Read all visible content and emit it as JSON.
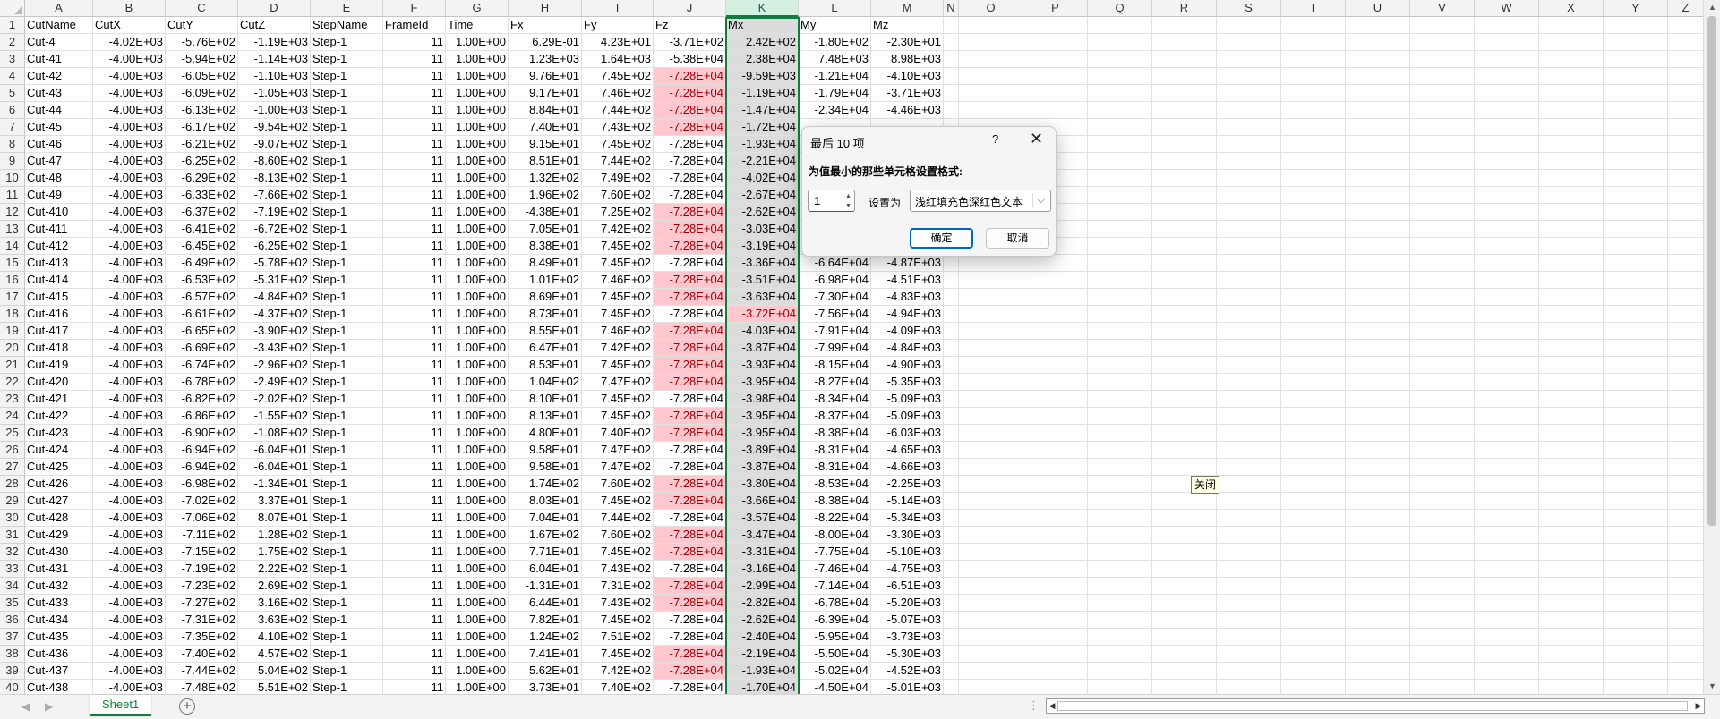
{
  "sheet": {
    "columns": [
      "A",
      "B",
      "C",
      "D",
      "E",
      "F",
      "G",
      "H",
      "I",
      "J",
      "K",
      "L",
      "M",
      "N",
      "O",
      "P",
      "Q",
      "R",
      "S",
      "T",
      "U",
      "V",
      "W",
      "X",
      "Y",
      "Z"
    ],
    "selected_column": "K",
    "row_numbers": [
      "1",
      "2",
      "3",
      "4",
      "5",
      "6",
      "7",
      "8",
      "9",
      "10",
      "11",
      "12",
      "13",
      "14",
      "15",
      "16",
      "17",
      "18",
      "19",
      "20",
      "21",
      "22",
      "23",
      "24",
      "25",
      "26",
      "27",
      "28",
      "29",
      "30",
      "31",
      "32",
      "33",
      "34",
      "35",
      "36",
      "37",
      "38",
      "39",
      "40"
    ],
    "headers": [
      "CutName",
      "CutX",
      "CutY",
      "CutZ",
      "StepName",
      "FrameId",
      "Time",
      "Fx",
      "Fy",
      "Fz",
      "Mx",
      "My",
      "Mz"
    ],
    "rows": [
      [
        "Cut-4",
        "-4.02E+03",
        "-5.76E+02",
        "-1.19E+03",
        "Step-1",
        "11",
        "1.00E+00",
        "6.29E-01",
        "4.23E+01",
        "-3.71E+02",
        "2.42E+02",
        "-1.80E+02",
        "-2.30E+01"
      ],
      [
        "Cut-41",
        "-4.00E+03",
        "-5.94E+02",
        "-1.14E+03",
        "Step-1",
        "11",
        "1.00E+00",
        "1.23E+03",
        "1.64E+03",
        "-5.38E+04",
        "2.38E+04",
        "7.48E+03",
        "8.98E+03"
      ],
      [
        "Cut-42",
        "-4.00E+03",
        "-6.05E+02",
        "-1.10E+03",
        "Step-1",
        "11",
        "1.00E+00",
        "9.76E+01",
        "7.45E+02",
        "-7.28E+04",
        "-9.59E+03",
        "-1.21E+04",
        "-4.10E+03"
      ],
      [
        "Cut-43",
        "-4.00E+03",
        "-6.09E+02",
        "-1.05E+03",
        "Step-1",
        "11",
        "1.00E+00",
        "9.17E+01",
        "7.46E+02",
        "-7.28E+04",
        "-1.19E+04",
        "-1.79E+04",
        "-3.71E+03"
      ],
      [
        "Cut-44",
        "-4.00E+03",
        "-6.13E+02",
        "-1.00E+03",
        "Step-1",
        "11",
        "1.00E+00",
        "8.84E+01",
        "7.44E+02",
        "-7.28E+04",
        "-1.47E+04",
        "-2.34E+04",
        "-4.46E+03"
      ],
      [
        "Cut-45",
        "-4.00E+03",
        "-6.17E+02",
        "-9.54E+02",
        "Step-1",
        "11",
        "1.00E+00",
        "7.40E+01",
        "7.43E+02",
        "-7.28E+04",
        "-1.72E+04",
        "",
        ""
      ],
      [
        "Cut-46",
        "-4.00E+03",
        "-6.21E+02",
        "-9.07E+02",
        "Step-1",
        "11",
        "1.00E+00",
        "9.15E+01",
        "7.45E+02",
        "-7.28E+04",
        "-1.93E+04",
        "",
        ""
      ],
      [
        "Cut-47",
        "-4.00E+03",
        "-6.25E+02",
        "-8.60E+02",
        "Step-1",
        "11",
        "1.00E+00",
        "8.51E+01",
        "7.44E+02",
        "-7.28E+04",
        "-2.21E+04",
        "",
        ""
      ],
      [
        "Cut-48",
        "-4.00E+03",
        "-6.29E+02",
        "-8.13E+02",
        "Step-1",
        "11",
        "1.00E+00",
        "1.32E+02",
        "7.49E+02",
        "-7.28E+04",
        "-4.02E+04",
        "",
        ""
      ],
      [
        "Cut-49",
        "-4.00E+03",
        "-6.33E+02",
        "-7.66E+02",
        "Step-1",
        "11",
        "1.00E+00",
        "1.96E+02",
        "7.60E+02",
        "-7.28E+04",
        "-2.67E+04",
        "",
        ""
      ],
      [
        "Cut-410",
        "-4.00E+03",
        "-6.37E+02",
        "-7.19E+02",
        "Step-1",
        "11",
        "1.00E+00",
        "-4.38E+01",
        "7.25E+02",
        "-7.28E+04",
        "-2.62E+04",
        "",
        ""
      ],
      [
        "Cut-411",
        "-4.00E+03",
        "-6.41E+02",
        "-6.72E+02",
        "Step-1",
        "11",
        "1.00E+00",
        "7.05E+01",
        "7.42E+02",
        "-7.28E+04",
        "-3.03E+04",
        "",
        ""
      ],
      [
        "Cut-412",
        "-4.00E+03",
        "-6.45E+02",
        "-6.25E+02",
        "Step-1",
        "11",
        "1.00E+00",
        "8.38E+01",
        "7.45E+02",
        "-7.28E+04",
        "-3.19E+04",
        "",
        ""
      ],
      [
        "Cut-413",
        "-4.00E+03",
        "-6.49E+02",
        "-5.78E+02",
        "Step-1",
        "11",
        "1.00E+00",
        "8.49E+01",
        "7.45E+02",
        "-7.28E+04",
        "-3.36E+04",
        "-6.64E+04",
        "-4.87E+03"
      ],
      [
        "Cut-414",
        "-4.00E+03",
        "-6.53E+02",
        "-5.31E+02",
        "Step-1",
        "11",
        "1.00E+00",
        "1.01E+02",
        "7.46E+02",
        "-7.28E+04",
        "-3.51E+04",
        "-6.98E+04",
        "-4.51E+03"
      ],
      [
        "Cut-415",
        "-4.00E+03",
        "-6.57E+02",
        "-4.84E+02",
        "Step-1",
        "11",
        "1.00E+00",
        "8.69E+01",
        "7.45E+02",
        "-7.28E+04",
        "-3.63E+04",
        "-7.30E+04",
        "-4.83E+03"
      ],
      [
        "Cut-416",
        "-4.00E+03",
        "-6.61E+02",
        "-4.37E+02",
        "Step-1",
        "11",
        "1.00E+00",
        "8.73E+01",
        "7.45E+02",
        "-7.28E+04",
        "-3.72E+04",
        "-7.56E+04",
        "-4.94E+03"
      ],
      [
        "Cut-417",
        "-4.00E+03",
        "-6.65E+02",
        "-3.90E+02",
        "Step-1",
        "11",
        "1.00E+00",
        "8.55E+01",
        "7.46E+02",
        "-7.28E+04",
        "-4.03E+04",
        "-7.91E+04",
        "-4.09E+03"
      ],
      [
        "Cut-418",
        "-4.00E+03",
        "-6.69E+02",
        "-3.43E+02",
        "Step-1",
        "11",
        "1.00E+00",
        "6.47E+01",
        "7.42E+02",
        "-7.28E+04",
        "-3.87E+04",
        "-7.99E+04",
        "-4.84E+03"
      ],
      [
        "Cut-419",
        "-4.00E+03",
        "-6.74E+02",
        "-2.96E+02",
        "Step-1",
        "11",
        "1.00E+00",
        "8.53E+01",
        "7.45E+02",
        "-7.28E+04",
        "-3.93E+04",
        "-8.15E+04",
        "-4.90E+03"
      ],
      [
        "Cut-420",
        "-4.00E+03",
        "-6.78E+02",
        "-2.49E+02",
        "Step-1",
        "11",
        "1.00E+00",
        "1.04E+02",
        "7.47E+02",
        "-7.28E+04",
        "-3.95E+04",
        "-8.27E+04",
        "-5.35E+03"
      ],
      [
        "Cut-421",
        "-4.00E+03",
        "-6.82E+02",
        "-2.02E+02",
        "Step-1",
        "11",
        "1.00E+00",
        "8.10E+01",
        "7.45E+02",
        "-7.28E+04",
        "-3.98E+04",
        "-8.34E+04",
        "-5.09E+03"
      ],
      [
        "Cut-422",
        "-4.00E+03",
        "-6.86E+02",
        "-1.55E+02",
        "Step-1",
        "11",
        "1.00E+00",
        "8.13E+01",
        "7.45E+02",
        "-7.28E+04",
        "-3.95E+04",
        "-8.37E+04",
        "-5.09E+03"
      ],
      [
        "Cut-423",
        "-4.00E+03",
        "-6.90E+02",
        "-1.08E+02",
        "Step-1",
        "11",
        "1.00E+00",
        "4.80E+01",
        "7.40E+02",
        "-7.28E+04",
        "-3.95E+04",
        "-8.38E+04",
        "-6.03E+03"
      ],
      [
        "Cut-424",
        "-4.00E+03",
        "-6.94E+02",
        "-6.04E+01",
        "Step-1",
        "11",
        "1.00E+00",
        "9.58E+01",
        "7.47E+02",
        "-7.28E+04",
        "-3.89E+04",
        "-8.31E+04",
        "-4.65E+03"
      ],
      [
        "Cut-425",
        "-4.00E+03",
        "-6.94E+02",
        "-6.04E+01",
        "Step-1",
        "11",
        "1.00E+00",
        "9.58E+01",
        "7.47E+02",
        "-7.28E+04",
        "-3.87E+04",
        "-8.31E+04",
        "-4.66E+03"
      ],
      [
        "Cut-426",
        "-4.00E+03",
        "-6.98E+02",
        "-1.34E+01",
        "Step-1",
        "11",
        "1.00E+00",
        "1.74E+02",
        "7.60E+02",
        "-7.28E+04",
        "-3.80E+04",
        "-8.53E+04",
        "-2.25E+03"
      ],
      [
        "Cut-427",
        "-4.00E+03",
        "-7.02E+02",
        "3.37E+01",
        "Step-1",
        "11",
        "1.00E+00",
        "8.03E+01",
        "7.45E+02",
        "-7.28E+04",
        "-3.66E+04",
        "-8.38E+04",
        "-5.14E+03"
      ],
      [
        "Cut-428",
        "-4.00E+03",
        "-7.06E+02",
        "8.07E+01",
        "Step-1",
        "11",
        "1.00E+00",
        "7.04E+01",
        "7.44E+02",
        "-7.28E+04",
        "-3.57E+04",
        "-8.22E+04",
        "-5.34E+03"
      ],
      [
        "Cut-429",
        "-4.00E+03",
        "-7.11E+02",
        "1.28E+02",
        "Step-1",
        "11",
        "1.00E+00",
        "1.67E+02",
        "7.60E+02",
        "-7.28E+04",
        "-3.47E+04",
        "-8.00E+04",
        "-3.30E+03"
      ],
      [
        "Cut-430",
        "-4.00E+03",
        "-7.15E+02",
        "1.75E+02",
        "Step-1",
        "11",
        "1.00E+00",
        "7.71E+01",
        "7.45E+02",
        "-7.28E+04",
        "-3.31E+04",
        "-7.75E+04",
        "-5.10E+03"
      ],
      [
        "Cut-431",
        "-4.00E+03",
        "-7.19E+02",
        "2.22E+02",
        "Step-1",
        "11",
        "1.00E+00",
        "6.04E+01",
        "7.43E+02",
        "-7.28E+04",
        "-3.16E+04",
        "-7.46E+04",
        "-4.75E+03"
      ],
      [
        "Cut-432",
        "-4.00E+03",
        "-7.23E+02",
        "2.69E+02",
        "Step-1",
        "11",
        "1.00E+00",
        "-1.31E+01",
        "7.31E+02",
        "-7.28E+04",
        "-2.99E+04",
        "-7.14E+04",
        "-6.51E+03"
      ],
      [
        "Cut-433",
        "-4.00E+03",
        "-7.27E+02",
        "3.16E+02",
        "Step-1",
        "11",
        "1.00E+00",
        "6.44E+01",
        "7.43E+02",
        "-7.28E+04",
        "-2.82E+04",
        "-6.78E+04",
        "-5.20E+03"
      ],
      [
        "Cut-434",
        "-4.00E+03",
        "-7.31E+02",
        "3.63E+02",
        "Step-1",
        "11",
        "1.00E+00",
        "7.82E+01",
        "7.45E+02",
        "-7.28E+04",
        "-2.62E+04",
        "-6.39E+04",
        "-5.07E+03"
      ],
      [
        "Cut-435",
        "-4.00E+03",
        "-7.35E+02",
        "4.10E+02",
        "Step-1",
        "11",
        "1.00E+00",
        "1.24E+02",
        "7.51E+02",
        "-7.28E+04",
        "-2.40E+04",
        "-5.95E+04",
        "-3.73E+03"
      ],
      [
        "Cut-436",
        "-4.00E+03",
        "-7.40E+02",
        "4.57E+02",
        "Step-1",
        "11",
        "1.00E+00",
        "7.41E+01",
        "7.45E+02",
        "-7.28E+04",
        "-2.19E+04",
        "-5.50E+04",
        "-5.30E+03"
      ],
      [
        "Cut-437",
        "-4.00E+03",
        "-7.44E+02",
        "5.04E+02",
        "Step-1",
        "11",
        "1.00E+00",
        "5.62E+01",
        "7.42E+02",
        "-7.28E+04",
        "-1.93E+04",
        "-5.02E+04",
        "-4.52E+03"
      ],
      [
        "Cut-438",
        "-4.00E+03",
        "-7.48E+02",
        "5.51E+02",
        "Step-1",
        "11",
        "1.00E+00",
        "3.73E+01",
        "7.40E+02",
        "-7.28E+04",
        "-1.70E+04",
        "-4.50E+04",
        "-5.01E+03"
      ]
    ],
    "fz_highlight_rows": [
      4,
      5,
      6,
      7,
      12,
      13,
      14,
      16,
      17,
      19,
      20,
      21,
      22,
      24,
      25,
      28,
      29,
      31,
      32,
      34,
      35,
      38,
      39
    ],
    "mx_highlight_rows": [
      18
    ]
  },
  "tabs": {
    "sheet_name": "Sheet1",
    "add_icon": "plus-circle-icon"
  },
  "tooltip": {
    "text": "关闭"
  },
  "dialog": {
    "title": "最后 10 项",
    "help": "?",
    "close": "✕",
    "instruction": "为值最小的那些单元格设置格式:",
    "count_value": "1",
    "set_as_label": "设置为",
    "format_option": "浅红填充色深红色文本",
    "ok_label": "确定",
    "cancel_label": "取消"
  },
  "colors": {
    "highlight_fill": "#ffc7ce",
    "highlight_text": "#9c0006",
    "accent": "#107c41",
    "primary_button_border": "#0067c0"
  }
}
